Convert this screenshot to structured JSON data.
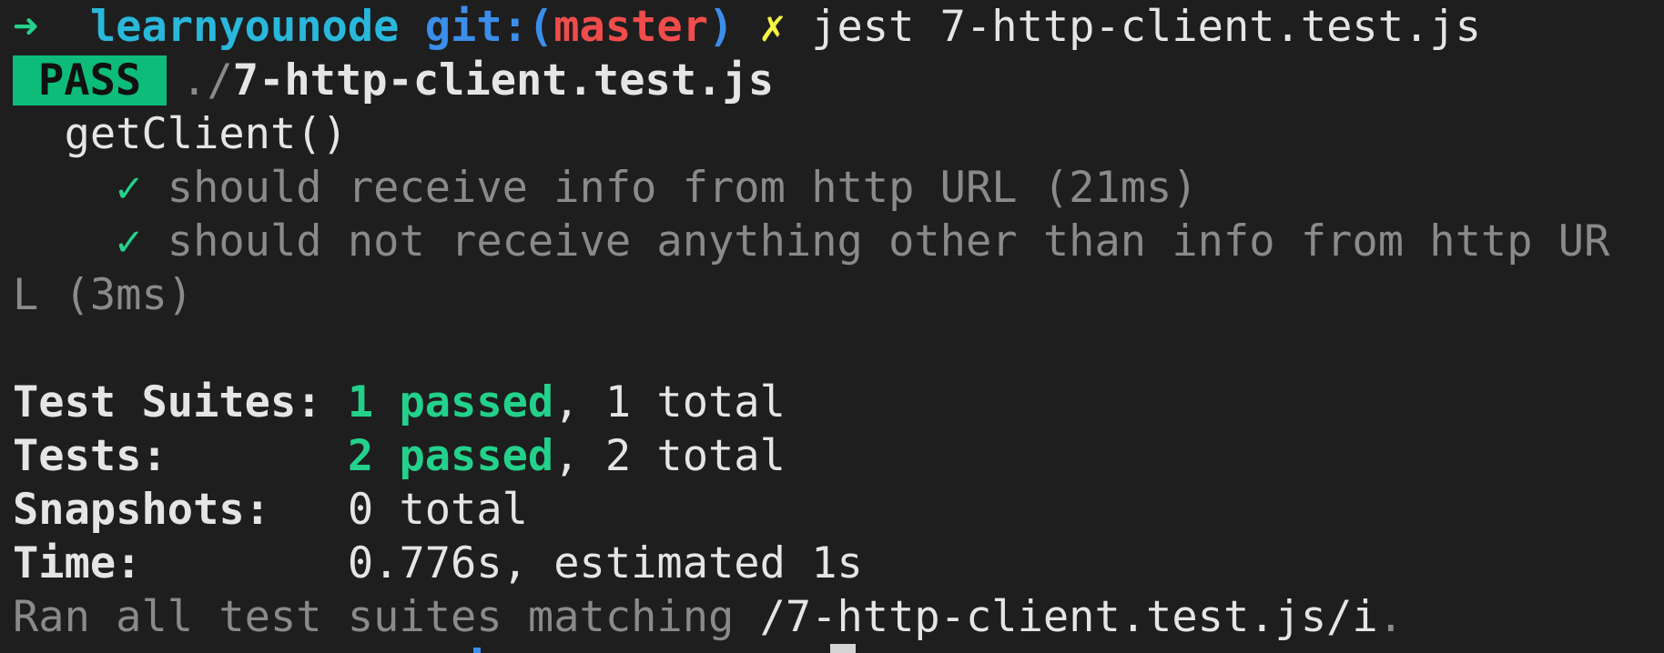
{
  "prompt": {
    "arrow": "➜",
    "directory": "learnyounode",
    "git_label": "git:(",
    "branch": "master",
    "git_close": ")",
    "dirty_mark": "✗",
    "command": "jest 7-http-client.test.js"
  },
  "result": {
    "status_badge": "PASS",
    "file_prefix": "./",
    "file_name": "7-http-client.test.js"
  },
  "suite": {
    "describe_name": "getClient()",
    "tests": [
      {
        "check": "✓",
        "name": "should receive info from http URL (21ms)"
      },
      {
        "check": "✓",
        "name": "should not receive anything other than info from http UR",
        "wrap": "L (3ms)"
      }
    ]
  },
  "summary": {
    "suites_label": "Test Suites: ",
    "suites_passed": "1 passed",
    "suites_total": ", 1 total",
    "tests_label": "Tests:       ",
    "tests_passed": "2 passed",
    "tests_total": ", 2 total",
    "snapshots_label": "Snapshots:   ",
    "snapshots_value": "0 total",
    "time_label": "Time:        ",
    "time_value": "0.776s, estimated 1s",
    "ran_prefix": "Ran all test suites matching ",
    "ran_pattern": "/7-http-client.test.js/i",
    "ran_suffix": "."
  },
  "colors": {
    "background": "#1e1e1e",
    "pass_badge": "#0dbc79",
    "green": "#23d18b",
    "cyan": "#29b8db",
    "blue": "#3b8eea",
    "red": "#f14c4c",
    "yellow": "#f5f543",
    "dim": "#8a8a8a"
  }
}
